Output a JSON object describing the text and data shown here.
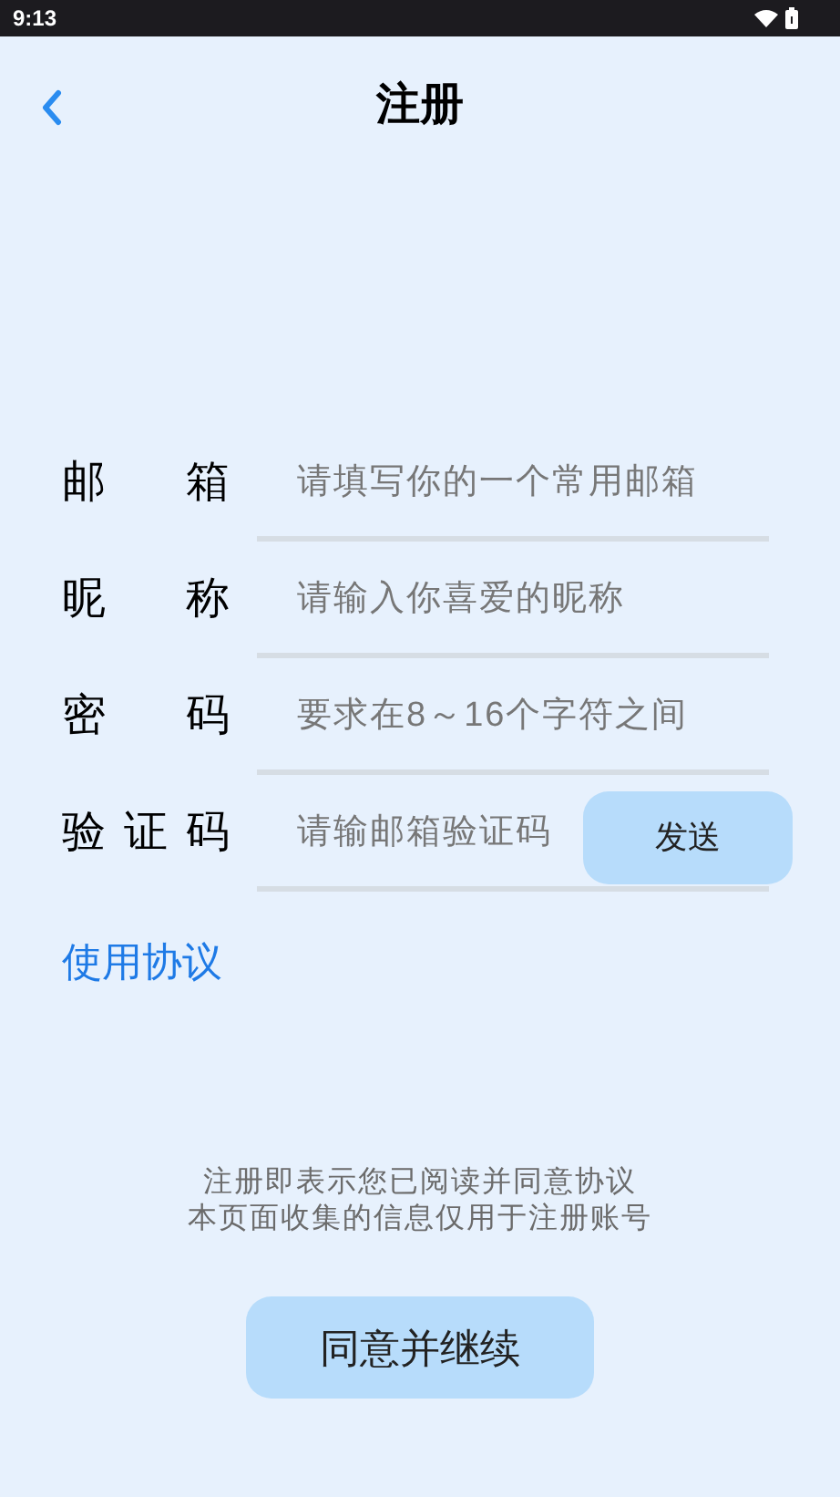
{
  "status_bar": {
    "time": "9:13"
  },
  "header": {
    "title": "注册"
  },
  "fields": [
    {
      "kind": "text",
      "label": "邮箱",
      "placeholder": "请填写你的一个常用邮箱"
    },
    {
      "kind": "text",
      "label": "昵称",
      "placeholder": "请输入你喜爱的昵称"
    },
    {
      "kind": "text",
      "label": "密码",
      "placeholder": "要求在8～16个字符之间"
    },
    {
      "kind": "code",
      "label": "验证码",
      "placeholder": "请输邮箱验证码",
      "button": "发送"
    }
  ],
  "agreement_link": "使用协议",
  "notice": [
    "注册即表示您已阅读并同意协议",
    "本页面收集的信息仅用于注册账号"
  ],
  "submit_button": "同意并继续"
}
